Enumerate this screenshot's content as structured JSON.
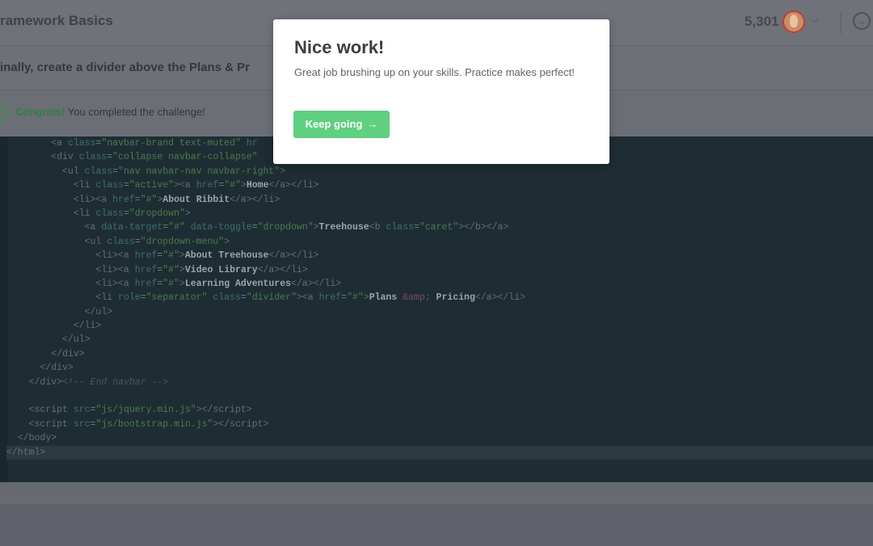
{
  "header": {
    "course_title": "ramework Basics",
    "points": "5,301",
    "chevron": "⌵",
    "next_icon": "→"
  },
  "challenge": {
    "instruction": "inally, create a divider above the Plans & Pr",
    "congrats_label": "Congrats!",
    "congrats_message": " You completed the challenge!",
    "check_icon": "✓"
  },
  "modal": {
    "title": "Nice work!",
    "body": "Great job brushing up on your skills. Practice makes perfect!",
    "button_label": "Keep going",
    "button_icon": "→"
  },
  "colors": {
    "accent_green": "#5fcf80",
    "editor_bg": "#1e2d33"
  }
}
